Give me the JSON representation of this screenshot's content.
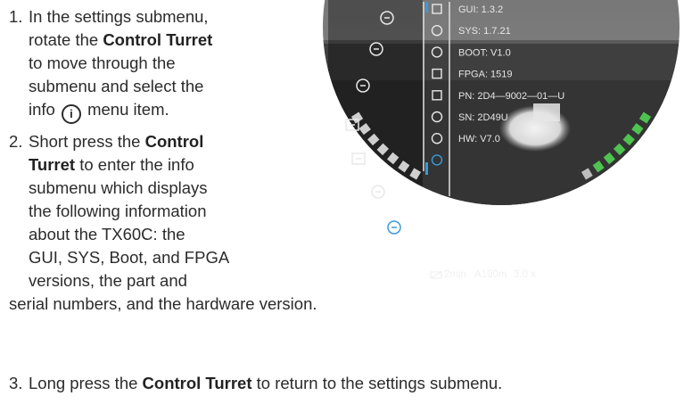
{
  "steps": [
    {
      "num": "1.",
      "lines": [
        [
          "In the settings submenu,"
        ],
        [
          "rotate the ",
          {
            "b": "Control Turret"
          }
        ],
        [
          "to move through the"
        ],
        [
          "submenu and select the"
        ],
        [
          "info ",
          {
            "icon": "i"
          },
          " menu item."
        ]
      ]
    },
    {
      "num": "2.",
      "lines": [
        [
          "Short press the ",
          {
            "b": "Control"
          }
        ],
        [
          {
            "b": "Turret"
          },
          " to enter the info"
        ],
        [
          "submenu which displays"
        ],
        [
          "the following information"
        ],
        [
          "about the TX60C: the"
        ],
        [
          "GUI, SYS, Boot, and FPGA"
        ],
        [
          "versions, the part and"
        ],
        [
          "serial numbers, and the hardware version.",
          {
            "outdent": true
          }
        ]
      ]
    },
    {
      "num": "3.",
      "lines": [
        [
          "Long press the ",
          {
            "b": "Control Turret"
          },
          " to return to the settings submenu."
        ]
      ]
    }
  ],
  "scope": {
    "info_items": [
      {
        "icon": "calendar-icon",
        "text": "GUI: 1.3.2"
      },
      {
        "icon": "clock-icon",
        "text": "SYS: 1.7.21"
      },
      {
        "icon": "globe-icon",
        "text": "BOOT: V1.0"
      },
      {
        "icon": "contrast-icon",
        "text": "FPGA: 1519"
      },
      {
        "icon": "display-icon",
        "text": "PN: 2D4—9002—01—U"
      },
      {
        "icon": "brightness-icon",
        "text": "SN: 2D49U"
      },
      {
        "icon": "refresh-icon",
        "text": "HW: V7.0"
      },
      {
        "icon": "info-icon",
        "text": ""
      }
    ],
    "left_menu_icons": [
      "rifle-icon",
      "crosshair-icon",
      "aperture-icon",
      "screen-off-icon",
      "plus-box-icon",
      "compass-icon",
      "gear-icon"
    ],
    "status_bar": {
      "timer": "2min",
      "range": "A100m",
      "zoom": "3.0 x"
    },
    "colors": {
      "accent_green": "#4fc34f",
      "info_blue": "#3a9ad9",
      "status_bar": "#111111"
    }
  }
}
